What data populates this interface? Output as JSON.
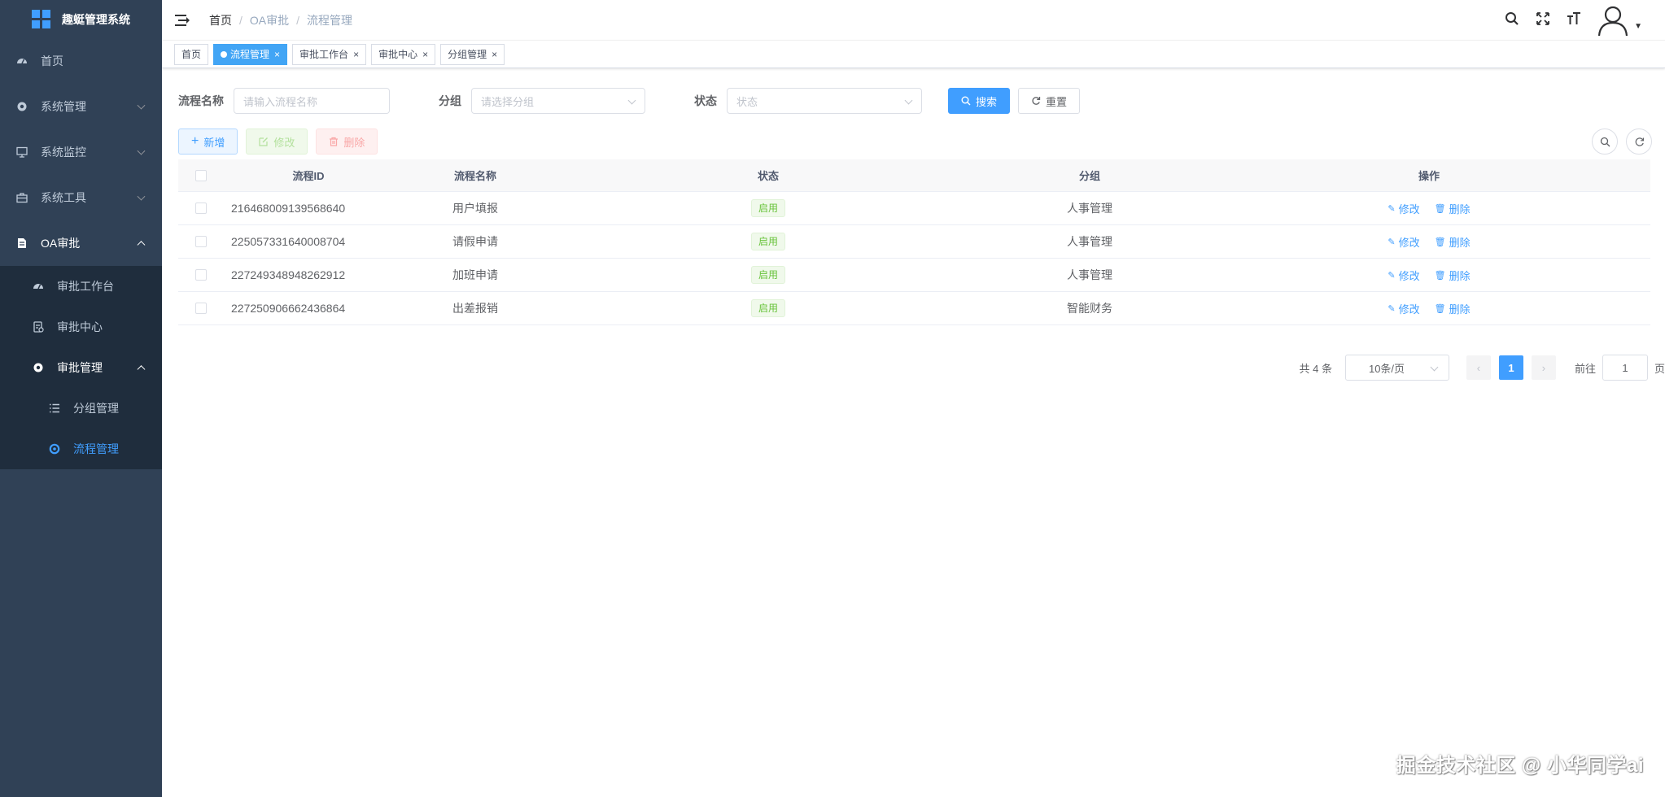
{
  "app": {
    "title": "趣蜓管理系统"
  },
  "sidebar": {
    "items": [
      {
        "label": "首页",
        "icon": "dashboard-icon"
      },
      {
        "label": "系统管理",
        "icon": "gear-icon"
      },
      {
        "label": "系统监控",
        "icon": "monitor-icon"
      },
      {
        "label": "系统工具",
        "icon": "toolbox-icon"
      },
      {
        "label": "OA审批",
        "icon": "document-icon"
      }
    ],
    "oa_sub": [
      {
        "label": "审批工作台",
        "icon": "dashboard-icon"
      },
      {
        "label": "审批中心",
        "icon": "approval-icon"
      },
      {
        "label": "审批管理",
        "icon": "gear-icon"
      }
    ],
    "approval_mgmt_sub": [
      {
        "label": "分组管理",
        "icon": "list-icon"
      },
      {
        "label": "流程管理",
        "icon": "flow-icon"
      }
    ]
  },
  "breadcrumb": {
    "home": "首页",
    "level1": "OA审批",
    "level2": "流程管理",
    "sep": "/"
  },
  "tags": [
    {
      "label": "首页"
    },
    {
      "label": "流程管理"
    },
    {
      "label": "审批工作台"
    },
    {
      "label": "审批中心"
    },
    {
      "label": "分组管理"
    }
  ],
  "search": {
    "name_label": "流程名称",
    "name_placeholder": "请输入流程名称",
    "group_label": "分组",
    "group_placeholder": "请选择分组",
    "status_label": "状态",
    "status_placeholder": "状态",
    "search_btn": "搜索",
    "reset_btn": "重置"
  },
  "toolbar": {
    "add": "新增",
    "edit": "修改",
    "delete": "删除"
  },
  "table": {
    "headers": {
      "id": "流程ID",
      "name": "流程名称",
      "status": "状态",
      "group": "分组",
      "op": "操作"
    },
    "rows": [
      {
        "id": "216468009139568640",
        "name": "用户填报",
        "status": "启用",
        "group": "人事管理"
      },
      {
        "id": "225057331640008704",
        "name": "请假申请",
        "status": "启用",
        "group": "人事管理"
      },
      {
        "id": "227249348948262912",
        "name": "加班申请",
        "status": "启用",
        "group": "人事管理"
      },
      {
        "id": "227250906662436864",
        "name": "出差报销",
        "status": "启用",
        "group": "智能财务"
      }
    ],
    "op_edit": "修改",
    "op_delete": "删除"
  },
  "pagination": {
    "total": "共 4 条",
    "page_size": "10条/页",
    "current": "1",
    "goto_label": "前往",
    "goto_value": "1",
    "page_suffix": "页"
  },
  "watermark": "掘金技术社区 @ 小华同学ai",
  "colors": {
    "sidebar": "#304156",
    "primary": "#409eff",
    "success": "#67c23a"
  }
}
